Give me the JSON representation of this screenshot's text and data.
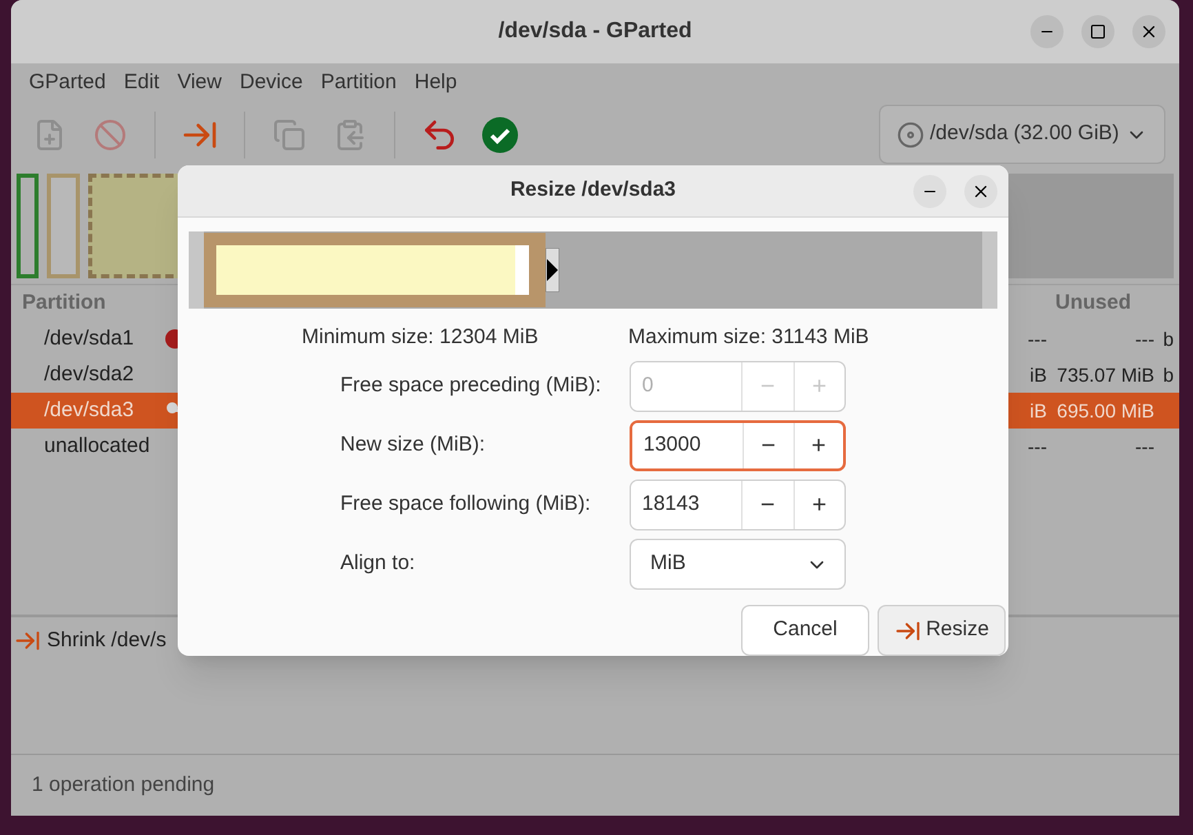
{
  "window": {
    "title": "/dev/sda - GParted"
  },
  "menu": [
    "GParted",
    "Edit",
    "View",
    "Device",
    "Partition",
    "Help"
  ],
  "toolbar": [
    {
      "kind": "new",
      "disabled": true
    },
    {
      "kind": "delete",
      "disabled": true
    },
    {
      "kind": "separator"
    },
    {
      "kind": "resize",
      "disabled": false
    },
    {
      "kind": "separator"
    },
    {
      "kind": "copy",
      "disabled": true
    },
    {
      "kind": "paste",
      "disabled": true
    },
    {
      "kind": "separator"
    },
    {
      "kind": "undo",
      "disabled": false
    },
    {
      "kind": "apply",
      "disabled": false
    }
  ],
  "device_selector": {
    "device": "/dev/sda",
    "size": "(32.00 GiB)"
  },
  "table": {
    "columns": [
      "Partition",
      "Unused"
    ],
    "rows": [
      {
        "name": "/dev/sda1",
        "kind": "warning",
        "cells": [
          "---",
          "---",
          "b"
        ],
        "selected": false
      },
      {
        "name": "/dev/sda2",
        "kind": "plain",
        "cells": [
          "iB",
          "735.07 MiB",
          "b"
        ],
        "selected": false
      },
      {
        "name": "/dev/sda3",
        "kind": "key",
        "cells": [
          "iB",
          "695.00 MiB",
          ""
        ],
        "selected": true
      },
      {
        "name": "unallocated",
        "kind": "plain",
        "cells": [
          "---",
          "---",
          ""
        ],
        "selected": false
      }
    ]
  },
  "operations": [
    {
      "text": "Shrink /dev/s"
    }
  ],
  "status_bar": "1 operation pending",
  "dialog": {
    "title": "Resize /dev/sda3",
    "minimum": "Minimum size: 12304 MiB",
    "maximum": "Maximum size: 31143 MiB",
    "fields": [
      {
        "kind": "spin",
        "label": "Free space preceding (MiB):",
        "value": "0",
        "disabled": true,
        "focused": false
      },
      {
        "kind": "spin",
        "label": "New size (MiB):",
        "value": "13000",
        "disabled": false,
        "focused": true
      },
      {
        "kind": "spin",
        "label": "Free space following (MiB):",
        "value": "18143",
        "disabled": false,
        "focused": false
      },
      {
        "kind": "combo",
        "label": "Align to:",
        "value": "MiB",
        "disabled": false,
        "focused": false
      }
    ],
    "buttons": [
      {
        "kind": "cancel",
        "label": "Cancel"
      },
      {
        "kind": "resize",
        "label": "Resize"
      }
    ],
    "spin_minus": "−",
    "spin_plus": "+"
  }
}
